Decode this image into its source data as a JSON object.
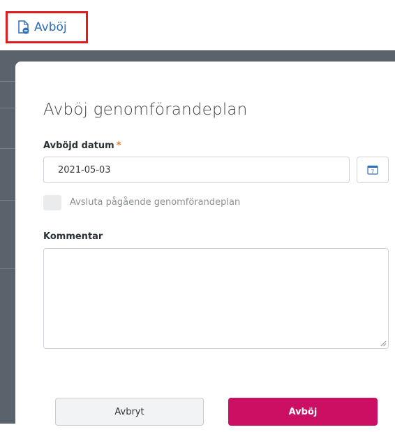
{
  "toolbar": {
    "avboj_label": "Avböj",
    "avboj_icon": "document-minus-icon"
  },
  "modal": {
    "title": "Avböj genomförandeplan",
    "date_label": "Avböjd datum",
    "required_mark": "*",
    "date_value": "2021-05-03",
    "calendar_icon": "calendar-icon",
    "calendar_day": "7",
    "checkbox_label": "Avsluta pågående genomförandeplan",
    "checkbox_checked": false,
    "comment_label": "Kommentar",
    "comment_value": "",
    "cancel_label": "Avbryt",
    "confirm_label": "Avböj"
  },
  "colors": {
    "accent_blue": "#2f6fb3",
    "highlight_red": "#e01b1b",
    "confirm_pink": "#cc0f63",
    "required_orange": "#e8762d"
  }
}
